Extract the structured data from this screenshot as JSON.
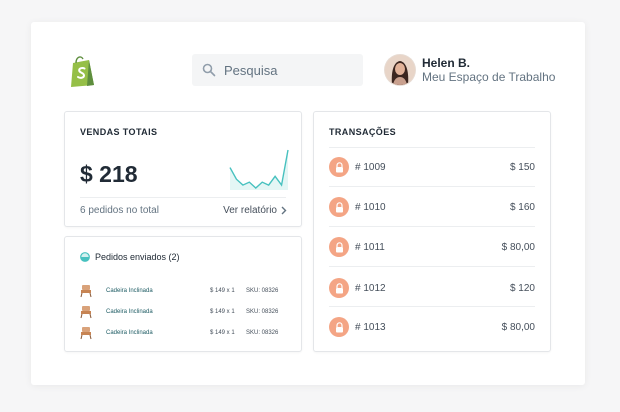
{
  "header": {
    "search": {
      "placeholder": "Pesquisa"
    },
    "user": {
      "name": "Helen B.",
      "store": "Meu Espaço de Trabalho"
    }
  },
  "sales": {
    "title": "VENDAS TOTAIS",
    "amount": "$ 218",
    "orders_text": "6 pedidos no total",
    "report_link": "Ver relatório",
    "sparkline_values": [
      6,
      4,
      3,
      3.5,
      2.5,
      3.5,
      3,
      4.5,
      3,
      9
    ]
  },
  "orders": {
    "title": "Pedidos enviados (2)",
    "items": [
      {
        "name": "Cadeira Inclinada",
        "qty": "$ 149 x 1",
        "sku": "SKU: 08326"
      },
      {
        "name": "Cadeira Inclinada",
        "qty": "$ 149 x 1",
        "sku": "SKU: 08326"
      },
      {
        "name": "Cadeira Inclinada",
        "qty": "$ 149 x 1",
        "sku": "SKU: 08326"
      }
    ]
  },
  "transactions": {
    "title": "TRANSAÇÕES",
    "items": [
      {
        "id": "# 1009",
        "amount": "$ 150"
      },
      {
        "id": "# 1010",
        "amount": "$ 160"
      },
      {
        "id": "# 1011",
        "amount": "$ 80,00"
      },
      {
        "id": "# 1012",
        "amount": "$ 120"
      },
      {
        "id": "# 1013",
        "amount": "$ 80,00"
      }
    ]
  },
  "colors": {
    "brand_green": "#95bf47",
    "sparkline": "#47c1bf",
    "lock_badge": "#f4a585"
  }
}
